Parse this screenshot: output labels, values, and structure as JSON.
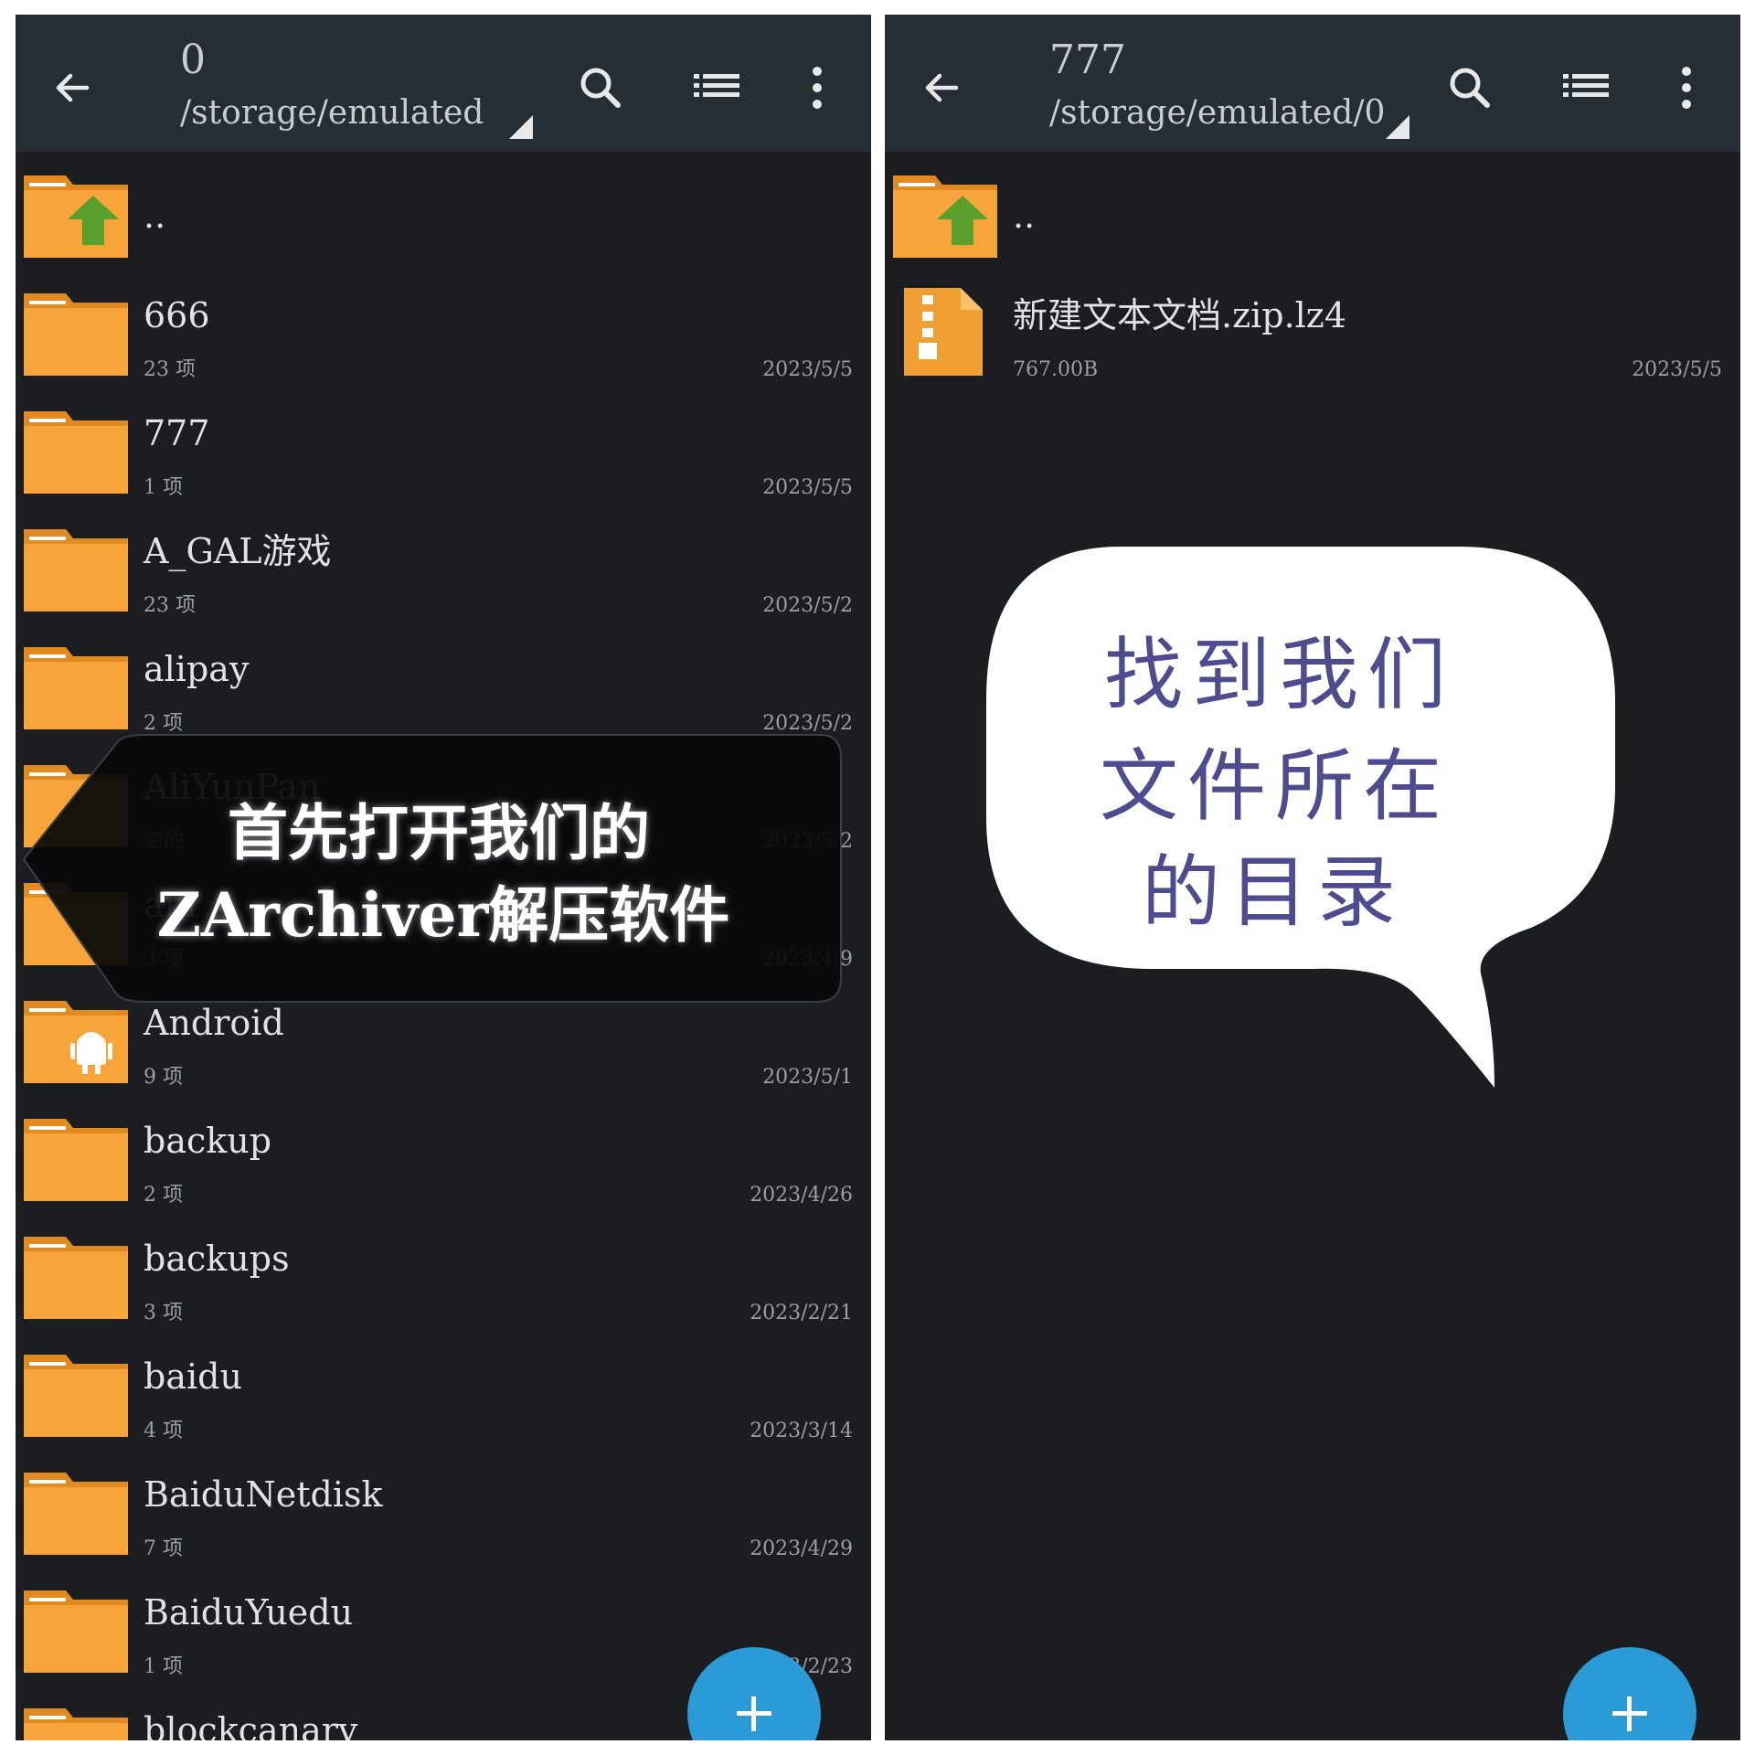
{
  "colors": {
    "toolbar": "#262e35",
    "background": "#1b1d21",
    "folder": "#f7a43a",
    "folder_dark": "#e08a1f",
    "fab": "#2a9bd6",
    "bubble_text": "#4f4b8f"
  },
  "icons": {
    "back": "arrow-left-icon",
    "search": "search-icon",
    "sort": "list-icon",
    "more": "more-vert-icon",
    "up": "folder-up-icon",
    "folder": "folder-icon",
    "android": "android-folder-icon",
    "archive": "archive-file-icon",
    "add": "plus-icon"
  },
  "left": {
    "title": "0",
    "path": "/storage/emulated",
    "up_label": "..",
    "items": [
      {
        "name": "666",
        "meta": "23 项",
        "date": "2023/5/5",
        "icon": "folder"
      },
      {
        "name": "777",
        "meta": "1 项",
        "date": "2023/5/5",
        "icon": "folder"
      },
      {
        "name": "A_GAL游戏",
        "meta": "23 项",
        "date": "2023/5/2",
        "icon": "folder"
      },
      {
        "name": "alipay",
        "meta": "2 项",
        "date": "2023/5/2",
        "icon": "folder"
      },
      {
        "name": "AliYunPan",
        "meta": "空的",
        "date": "2023/5/2",
        "icon": "folder"
      },
      {
        "name": "am",
        "meta": "3 项",
        "date": "2023/4/9",
        "icon": "folder"
      },
      {
        "name": "Android",
        "meta": "9 项",
        "date": "2023/5/1",
        "icon": "android"
      },
      {
        "name": "backup",
        "meta": "2 项",
        "date": "2023/4/26",
        "icon": "folder"
      },
      {
        "name": "backups",
        "meta": "3 项",
        "date": "2023/2/21",
        "icon": "folder"
      },
      {
        "name": "baidu",
        "meta": "4 项",
        "date": "2023/3/14",
        "icon": "folder"
      },
      {
        "name": "BaiduNetdisk",
        "meta": "7 项",
        "date": "2023/4/29",
        "icon": "folder"
      },
      {
        "name": "BaiduYuedu",
        "meta": "1 项",
        "date": "2023/2/23",
        "icon": "folder"
      },
      {
        "name": "blockcanary",
        "meta": "",
        "date": "",
        "icon": "folder"
      }
    ],
    "callout": {
      "line1": "首先打开我们的",
      "line2": "ZArchiver解压软件"
    }
  },
  "right": {
    "title": "777",
    "path": "/storage/emulated/0",
    "up_label": "..",
    "items": [
      {
        "name": "新建文本文档.zip.lz4",
        "meta": "767.00B",
        "date": "2023/5/5",
        "icon": "archive"
      }
    ],
    "bubble": {
      "line1": "找到我们",
      "line2": "文件所在",
      "line3": "的目录"
    }
  }
}
